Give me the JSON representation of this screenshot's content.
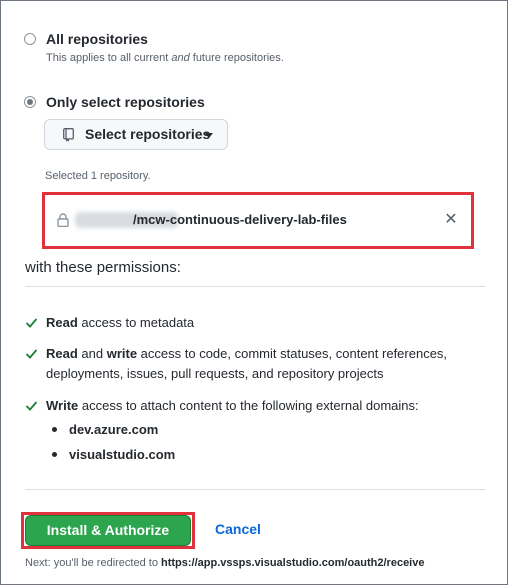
{
  "access": {
    "all": {
      "label": "All repositories",
      "note_prefix": "This applies to all current ",
      "note_em": "and",
      "note_suffix": " future repositories.",
      "checked": false
    },
    "select": {
      "label": "Only select repositories",
      "checked": true
    }
  },
  "select_button": {
    "label": "Select repositories",
    "icon": "repo-icon"
  },
  "selected_count": "Selected 1 repository.",
  "selected_repo": {
    "name": "/mcw-continuous-delivery-lab-files",
    "remove_glyph": "✕",
    "icon": "lock-icon"
  },
  "permissions": {
    "heading": "with these permissions:",
    "items": [
      {
        "bold": "Read",
        "rest": " access to metadata"
      },
      {
        "bold": "Read",
        "mid": " and ",
        "bold2": "write",
        "rest": " access to code, commit statuses, content references, deployments, issues, pull requests, and repository projects"
      },
      {
        "bold": "Write",
        "rest": " access to attach content to the following external domains:"
      }
    ],
    "domains": [
      "dev.azure.com",
      "visualstudio.com"
    ]
  },
  "actions": {
    "install_label": "Install & Authorize",
    "cancel_label": "Cancel"
  },
  "redirect": {
    "prefix": "Next: you'll be redirected to ",
    "url": "https://app.vssps.visualstudio.com/oauth2/receive"
  },
  "colors": {
    "primary": "#2da44e",
    "link": "#0969da",
    "highlight": "#e0323c",
    "check": "#1a7f37"
  }
}
